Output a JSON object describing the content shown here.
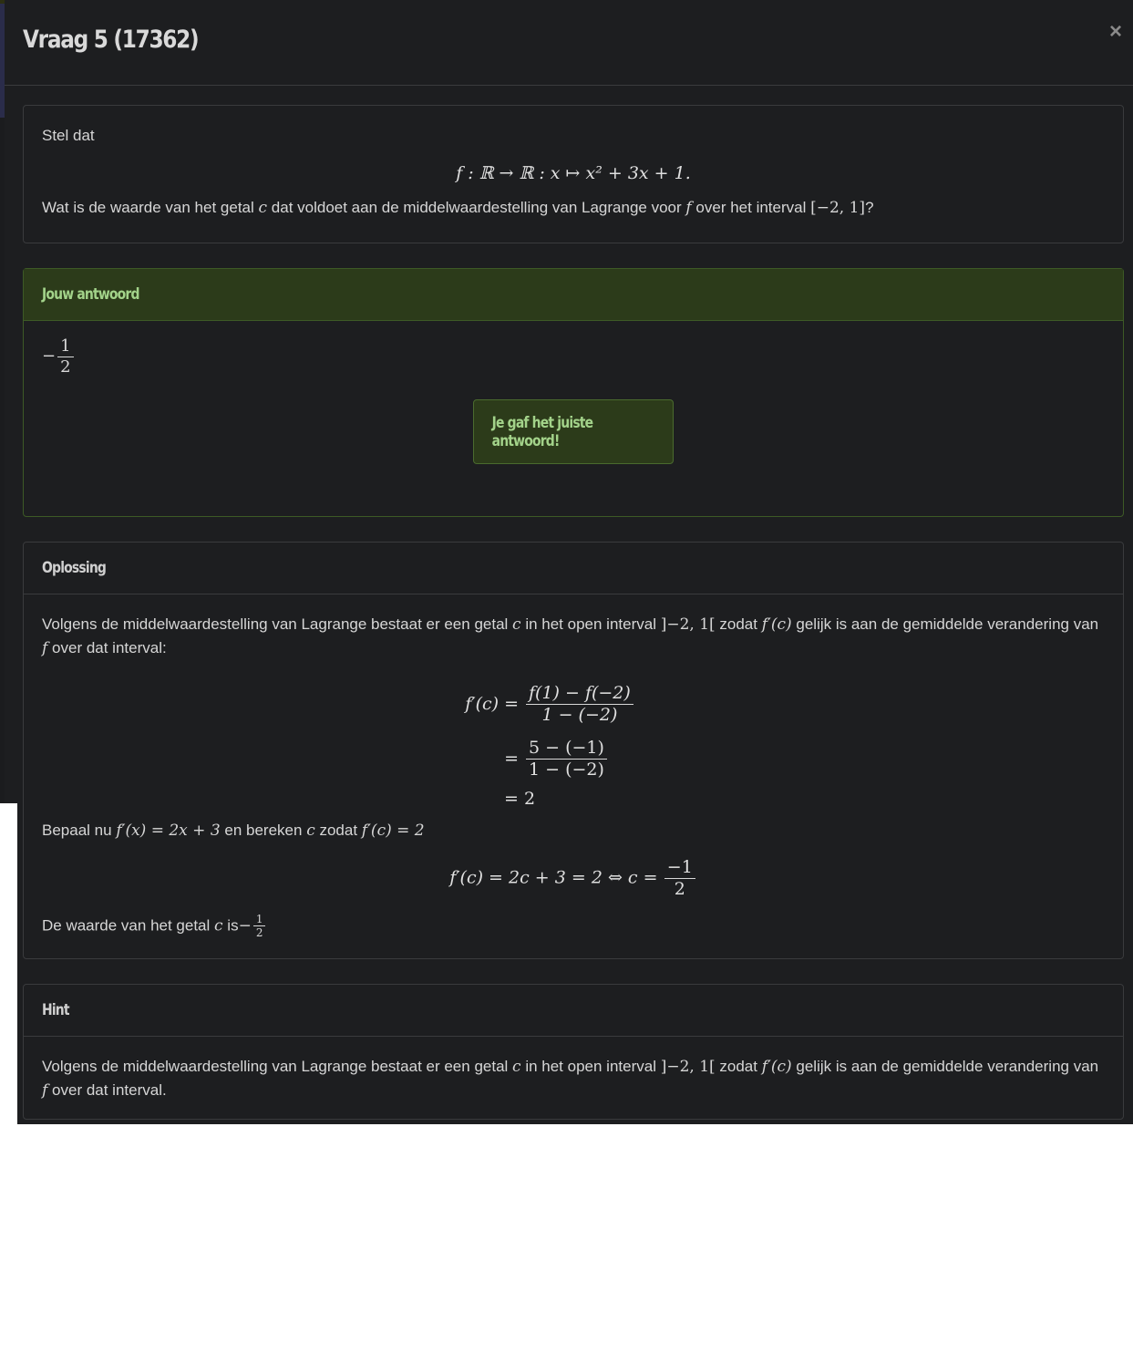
{
  "modal": {
    "title": "Vraag 5 (17362)",
    "close_glyph": "×"
  },
  "question": {
    "intro": "Stel dat",
    "formula": "f : ℝ → ℝ : x ↦ x² + 3x + 1.",
    "prompt_before_c": "Wat is de waarde van het getal",
    "c": "c",
    "prompt_mid": "dat voldoet aan de middelwaardestelling van Lagrange voor",
    "f": "f",
    "prompt_after_f": "over het interval",
    "interval": "[−2, 1]",
    "q_mark": "?"
  },
  "answer": {
    "header": "Jouw antwoord",
    "value_sign": "−",
    "value_num": "1",
    "value_den": "2",
    "feedback": "Je gaf het juiste antwoord!"
  },
  "solution": {
    "header": "Oplossing",
    "p1_a": "Volgens de middelwaardestelling van Lagrange bestaat er een getal",
    "p1_c": "c",
    "p1_b": "in het open interval",
    "p1_interval": "]−2, 1[",
    "p1_c2": "zodat",
    "p1_fpc": "f′(c)",
    "p1_d": "gelijk is aan de gemiddelde verandering van",
    "p1_f": "f",
    "p1_e": "over dat interval:",
    "eq1_lhs": "f′(c) =",
    "eq1_num": "f(1) − f(−2)",
    "eq1_den": "1 − (−2)",
    "eq2_eq": "=",
    "eq2_num": "5 − (−1)",
    "eq2_den": "1 − (−2)",
    "eq3": "= 2",
    "p2_a": "Bepaal nu",
    "p2_fx": "f′(x) = 2x + 3",
    "p2_b": "en bereken",
    "p2_c": "c",
    "p2_c2": "zodat",
    "p2_fc": "f′(c) = 2",
    "eq4_a": "f′(c) = 2c + 3 = 2 ⇔ c =",
    "eq4_num": "−1",
    "eq4_den": "2",
    "p3_a": "De waarde van het getal",
    "p3_c": "c",
    "p3_b": "is",
    "p3_sign": "−",
    "p3_num": "1",
    "p3_den": "2"
  },
  "hint": {
    "header": "Hint",
    "p_a": "Volgens de middelwaardestelling van Lagrange bestaat er een getal",
    "p_c": "c",
    "p_b": "in het open interval",
    "p_interval": "]−2, 1[",
    "p_zodat": "zodat",
    "p_fpc": "f′(c)",
    "p_d": "gelijk is aan de gemiddelde verandering van",
    "p_f": "f",
    "p_e": "over dat interval."
  }
}
